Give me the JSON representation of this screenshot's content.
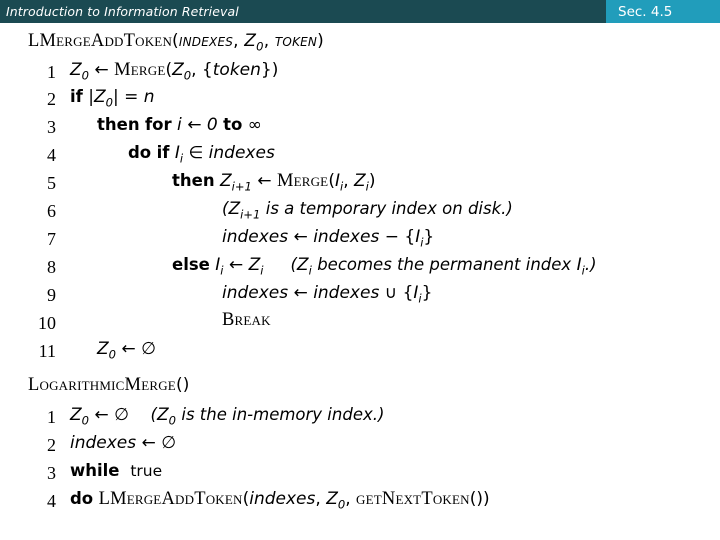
{
  "header": {
    "course_title": "Introduction to Information Retrieval",
    "section_badge": "Sec. 4.5",
    "bar_color": "#1b4a52",
    "badge_color": "#219dbb",
    "text_color": "#ffffff"
  },
  "algorithms": [
    {
      "id": "lmerge-add-token",
      "title": "LMergeAddToken(indexes, Z0, token)",
      "lines": [
        {
          "no": "1",
          "text": "Z0 ← Merge(Z0, {token})"
        },
        {
          "no": "2",
          "text": "if |Z0| = n"
        },
        {
          "no": "3",
          "text": "then for i ← 0 to ∞"
        },
        {
          "no": "4",
          "text": "do if Ii ∈ indexes"
        },
        {
          "no": "5",
          "text": "then Zi+1 ← Merge(Ii, Zi)"
        },
        {
          "no": "6",
          "text": "(Zi+1 is a temporary index on disk.)"
        },
        {
          "no": "7",
          "text": "indexes ← indexes − {Ii}"
        },
        {
          "no": "8",
          "text": "else Ii ← Zi    (Zi becomes the permanent index Ii.)"
        },
        {
          "no": "9",
          "text": "indexes ← indexes ∪ {Ii}"
        },
        {
          "no": "10",
          "text": "Break"
        },
        {
          "no": "11",
          "text": "Z0 ← ∅"
        }
      ]
    },
    {
      "id": "logarithmic-merge",
      "title": "LogarithmicMerge()",
      "lines": [
        {
          "no": "1",
          "text": "Z0 ← ∅    (Z0 is the in-memory index.)"
        },
        {
          "no": "2",
          "text": "indexes ← ∅"
        },
        {
          "no": "3",
          "text": "while true"
        },
        {
          "no": "4",
          "text": "do LMergeAddToken(indexes, Z0, getNextToken())"
        }
      ]
    }
  ],
  "tokens": {
    "t_lmerge": "LMergeAddToken",
    "t_merge": "Merge",
    "t_break": "Break",
    "t_getnext": "getNextToken",
    "t_logmerge": "LogarithmicMerge",
    "kw_if": "if",
    "kw_then": "then",
    "kw_for": "for",
    "kw_to": "to",
    "kw_do": "do",
    "kw_else": "else",
    "kw_while": "while",
    "lit_true": "true",
    "v_indexes": "indexes",
    "v_token": "token",
    "v_n": "n",
    "v_i": "i",
    "arrow": "←",
    "infinity": "∞",
    "elem": "∈",
    "union": "∪",
    "minus": "−",
    "emptyset": "∅",
    "eq": "=",
    "cmt6": "is a temporary index on disk.",
    "cmt8": "becomes the permanent index",
    "cmt1b": "is the in-memory index."
  }
}
